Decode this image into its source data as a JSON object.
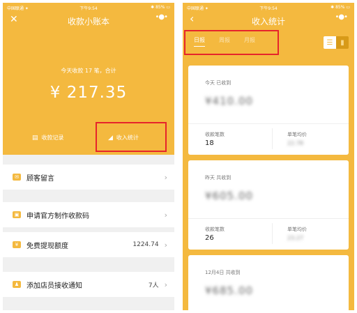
{
  "left": {
    "status": {
      "carrier": "中国联通 ✦",
      "time": "下午9:54",
      "battery": "✱ 85% ▭"
    },
    "nav": {
      "back": "✕",
      "title": "收款小账本",
      "more": "•●•"
    },
    "summary": "今天收款 17 笔，合计",
    "amount": "¥ 217.35",
    "records_label": "收款记录",
    "stats_label": "收入统计",
    "list": [
      {
        "label": "顾客留言",
        "value": "",
        "icon": "message-icon"
      },
      {
        "label": "申请官方制作收款码",
        "value": "",
        "icon": "qrcode-icon"
      },
      {
        "label": "免费提现额度",
        "value": "1224.74",
        "icon": "wallet-icon"
      },
      {
        "label": "添加店员接收通知",
        "value": "7人",
        "icon": "staff-icon"
      }
    ],
    "chevron": "›"
  },
  "right": {
    "status": {
      "carrier": "中国联通 ✦",
      "time": "下午9:54",
      "battery": "✱ 85% ▭"
    },
    "nav": {
      "back": "‹",
      "title": "收入统计",
      "more": "•●•"
    },
    "tabs": [
      "日报",
      "周报",
      "月报"
    ],
    "cards": [
      {
        "label": "今天 已收到",
        "amount": "¥410.00",
        "count_label": "收款笔数",
        "count": "18",
        "avg_label": "单笔均价",
        "avg": "22.78"
      },
      {
        "label": "昨天 共收到",
        "amount": "¥605.00",
        "count_label": "收款笔数",
        "count": "26",
        "avg_label": "单笔均价",
        "avg": "23.27"
      },
      {
        "label": "12月4日 共收到",
        "amount": "¥685.00"
      }
    ]
  },
  "colors": {
    "brand_yellow": "#f4b93f",
    "highlight_red": "#e6242b"
  }
}
